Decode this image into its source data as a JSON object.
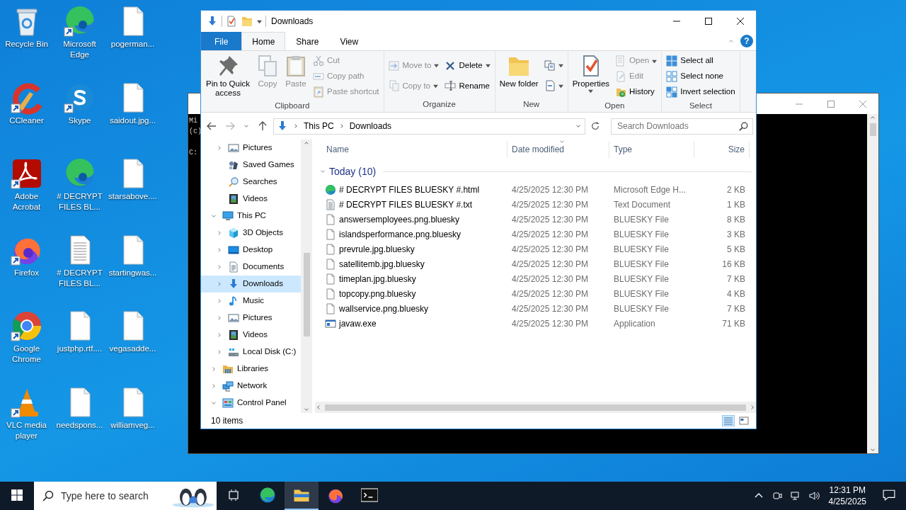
{
  "desktop_icons": [
    {
      "label": "Recycle Bin",
      "kind": "recycle",
      "shortcut": false
    },
    {
      "label": "Microsoft Edge",
      "kind": "edge",
      "shortcut": true
    },
    {
      "label": "pogerman...",
      "kind": "blank",
      "shortcut": false
    },
    {
      "label": "CCleaner",
      "kind": "ccleaner",
      "shortcut": true
    },
    {
      "label": "Skype",
      "kind": "skype",
      "shortcut": true
    },
    {
      "label": "saidout.jpg...",
      "kind": "blank",
      "shortcut": false
    },
    {
      "label": "Adobe Acrobat",
      "kind": "acrobat",
      "shortcut": true
    },
    {
      "label": "# DECRYPT FILES BL...",
      "kind": "edge",
      "shortcut": false
    },
    {
      "label": "starsabove....",
      "kind": "blank",
      "shortcut": false
    },
    {
      "label": "Firefox",
      "kind": "firefox",
      "shortcut": true
    },
    {
      "label": "# DECRYPT FILES BL...",
      "kind": "text",
      "shortcut": false
    },
    {
      "label": "startingwas...",
      "kind": "blank",
      "shortcut": false
    },
    {
      "label": "Google Chrome",
      "kind": "chrome",
      "shortcut": true
    },
    {
      "label": "justphp.rtf....",
      "kind": "blank",
      "shortcut": false
    },
    {
      "label": "vegasadde...",
      "kind": "blank",
      "shortcut": false
    },
    {
      "label": "VLC media player",
      "kind": "vlc",
      "shortcut": true
    },
    {
      "label": "needspons...",
      "kind": "blank",
      "shortcut": false
    },
    {
      "label": "williamveg...",
      "kind": "blank",
      "shortcut": false
    }
  ],
  "console_window": {
    "lines": [
      "Mi",
      "(c)",
      "C:"
    ]
  },
  "explorer": {
    "title": "Downloads",
    "ribbon_tabs": [
      {
        "label": "File",
        "kind": "file",
        "selected": false
      },
      {
        "label": "Home",
        "kind": "tab",
        "selected": true
      },
      {
        "label": "Share",
        "kind": "tab",
        "selected": false
      },
      {
        "label": "View",
        "kind": "tab",
        "selected": false
      }
    ],
    "help_button": "?",
    "ribbon_groups": [
      {
        "label": "Clipboard",
        "stacks": [
          [
            {
              "label": "Pin to Quick access",
              "kind": "pin",
              "large": true,
              "disabled": false,
              "dropdown": false
            }
          ],
          [
            {
              "label": "Copy",
              "kind": "copy",
              "large": true,
              "disabled": true,
              "dropdown": false
            }
          ],
          [
            {
              "label": "Paste",
              "kind": "paste",
              "large": true,
              "disabled": true,
              "dropdown": false
            }
          ],
          [
            {
              "label": "Cut",
              "kind": "cut",
              "large": false,
              "disabled": true,
              "dropdown": false
            },
            {
              "label": "Copy path",
              "kind": "copypath",
              "large": false,
              "disabled": true,
              "dropdown": false
            },
            {
              "label": "Paste shortcut",
              "kind": "pasteshortcut",
              "large": false,
              "disabled": true,
              "dropdown": false
            }
          ]
        ]
      },
      {
        "label": "Organize",
        "stacks": [
          [
            {
              "label": "Move to",
              "kind": "moveto",
              "large": false,
              "disabled": true,
              "dropdown": true
            },
            {
              "label": "Copy to",
              "kind": "copyto",
              "large": false,
              "disabled": true,
              "dropdown": true
            }
          ],
          [
            {
              "label": "Delete",
              "kind": "delete",
              "large": false,
              "disabled": false,
              "dropdown": true
            },
            {
              "label": "Rename",
              "kind": "rename",
              "large": false,
              "disabled": false,
              "dropdown": false
            }
          ]
        ]
      },
      {
        "label": "New",
        "stacks": [
          [
            {
              "label": "New folder",
              "kind": "newfolder",
              "large": true,
              "disabled": false,
              "dropdown": false
            }
          ],
          [
            {
              "kind": "newitem",
              "large": false,
              "disabled": false,
              "dropdown": true
            },
            {
              "kind": "easyaccess",
              "large": false,
              "disabled": false,
              "dropdown": true
            }
          ]
        ]
      },
      {
        "label": "Open",
        "stacks": [
          [
            {
              "label": "Properties",
              "kind": "properties",
              "large": true,
              "disabled": false,
              "dropdown": true
            }
          ],
          [
            {
              "label": "Open",
              "kind": "open",
              "large": false,
              "disabled": true,
              "dropdown": true
            },
            {
              "label": "Edit",
              "kind": "edit",
              "large": false,
              "disabled": true,
              "dropdown": false
            },
            {
              "label": "History",
              "kind": "history",
              "large": false,
              "disabled": false,
              "dropdown": false
            }
          ]
        ]
      },
      {
        "label": "Select",
        "stacks": [
          [
            {
              "label": "Select all",
              "kind": "selectall",
              "large": false,
              "disabled": false,
              "dropdown": false
            },
            {
              "label": "Select none",
              "kind": "selectnone",
              "large": false,
              "disabled": false,
              "dropdown": false
            },
            {
              "label": "Invert selection",
              "kind": "invert",
              "large": false,
              "disabled": false,
              "dropdown": false
            }
          ]
        ]
      }
    ],
    "address": {
      "crumbs": [
        "This PC",
        "Downloads"
      ]
    },
    "search": {
      "placeholder": "Search Downloads"
    },
    "nav_tree": [
      {
        "children": [
          {
            "label": "Pictures",
            "kind": "pictures",
            "expandable": true,
            "expanded": false,
            "selected": false
          },
          {
            "label": "Saved Games",
            "kind": "games",
            "expandable": false,
            "selected": false
          },
          {
            "label": "Searches",
            "kind": "search",
            "expandable": false,
            "selected": false
          },
          {
            "label": "Videos",
            "kind": "videos",
            "expandable": false,
            "selected": false
          }
        ]
      },
      {
        "label": "This PC",
        "kind": "pc",
        "expandable": true,
        "expanded": true,
        "selected": false,
        "children": [
          {
            "label": "3D Objects",
            "kind": "cube",
            "expandable": true,
            "expanded": false,
            "selected": false
          },
          {
            "label": "Desktop",
            "kind": "desktop",
            "expandable": true,
            "expanded": false,
            "selected": false
          },
          {
            "label": "Documents",
            "kind": "documents",
            "expandable": true,
            "expanded": false,
            "selected": false
          },
          {
            "label": "Downloads",
            "kind": "download",
            "expandable": true,
            "expanded": false,
            "selected": true
          },
          {
            "label": "Music",
            "kind": "music",
            "expandable": true,
            "expanded": false,
            "selected": false
          },
          {
            "label": "Pictures",
            "kind": "pictures",
            "expandable": true,
            "expanded": false,
            "selected": false
          },
          {
            "label": "Videos",
            "kind": "videos",
            "expandable": true,
            "expanded": false,
            "selected": false
          },
          {
            "label": "Local Disk (C:)",
            "kind": "disk",
            "expandable": true,
            "expanded": false,
            "selected": false
          }
        ]
      },
      {
        "label": "Libraries",
        "kind": "libraries",
        "expandable": true,
        "expanded": false,
        "selected": false
      },
      {
        "label": "Network",
        "kind": "network",
        "expandable": true,
        "expanded": false,
        "selected": false
      },
      {
        "label": "Control Panel",
        "kind": "controlpanel",
        "expandable": true,
        "expanded": true,
        "selected": false
      }
    ],
    "columns": [
      {
        "label": "Name",
        "sorted": false
      },
      {
        "label": "Date modified",
        "sorted": true
      },
      {
        "label": "Type",
        "sorted": false
      },
      {
        "label": "Size",
        "sorted": false
      }
    ],
    "groups": [
      {
        "label": "Today (10)",
        "expanded": true,
        "rows": [
          {
            "name": "# DECRYPT FILES BLUESKY #.html",
            "kind": "edge",
            "date": "4/25/2025 12:30 PM",
            "type": "Microsoft Edge H...",
            "size": "2 KB"
          },
          {
            "name": "# DECRYPT FILES BLUESKY #.txt",
            "kind": "text",
            "date": "4/25/2025 12:30 PM",
            "type": "Text Document",
            "size": "1 KB"
          },
          {
            "name": "answersemployees.png.bluesky",
            "kind": "blank",
            "date": "4/25/2025 12:30 PM",
            "type": "BLUESKY File",
            "size": "8 KB"
          },
          {
            "name": "islandsperformance.png.bluesky",
            "kind": "blank",
            "date": "4/25/2025 12:30 PM",
            "type": "BLUESKY File",
            "size": "3 KB"
          },
          {
            "name": "prevrule.jpg.bluesky",
            "kind": "blank",
            "date": "4/25/2025 12:30 PM",
            "type": "BLUESKY File",
            "size": "5 KB"
          },
          {
            "name": "satellitemb.jpg.bluesky",
            "kind": "blank",
            "date": "4/25/2025 12:30 PM",
            "type": "BLUESKY File",
            "size": "16 KB"
          },
          {
            "name": "timeplan.jpg.bluesky",
            "kind": "blank",
            "date": "4/25/2025 12:30 PM",
            "type": "BLUESKY File",
            "size": "7 KB"
          },
          {
            "name": "topcopy.png.bluesky",
            "kind": "blank",
            "date": "4/25/2025 12:30 PM",
            "type": "BLUESKY File",
            "size": "4 KB"
          },
          {
            "name": "wallservice.png.bluesky",
            "kind": "blank",
            "date": "4/25/2025 12:30 PM",
            "type": "BLUESKY File",
            "size": "7 KB"
          },
          {
            "name": "javaw.exe",
            "kind": "exe",
            "date": "4/25/2025 12:30 PM",
            "type": "Application",
            "size": "71 KB"
          }
        ]
      }
    ],
    "status": "10 items",
    "views": [
      {
        "kind": "details",
        "selected": true
      },
      {
        "kind": "tiles",
        "selected": false
      }
    ]
  },
  "taskbar": {
    "search_placeholder": "Type here to search",
    "apps": [
      {
        "kind": "taskview",
        "selected": false
      },
      {
        "kind": "edge",
        "selected": false
      },
      {
        "kind": "explorer",
        "selected": true
      },
      {
        "kind": "firefox",
        "selected": false
      },
      {
        "kind": "cmd",
        "selected": false
      }
    ],
    "time": "12:31 PM",
    "date": "4/25/2025"
  }
}
